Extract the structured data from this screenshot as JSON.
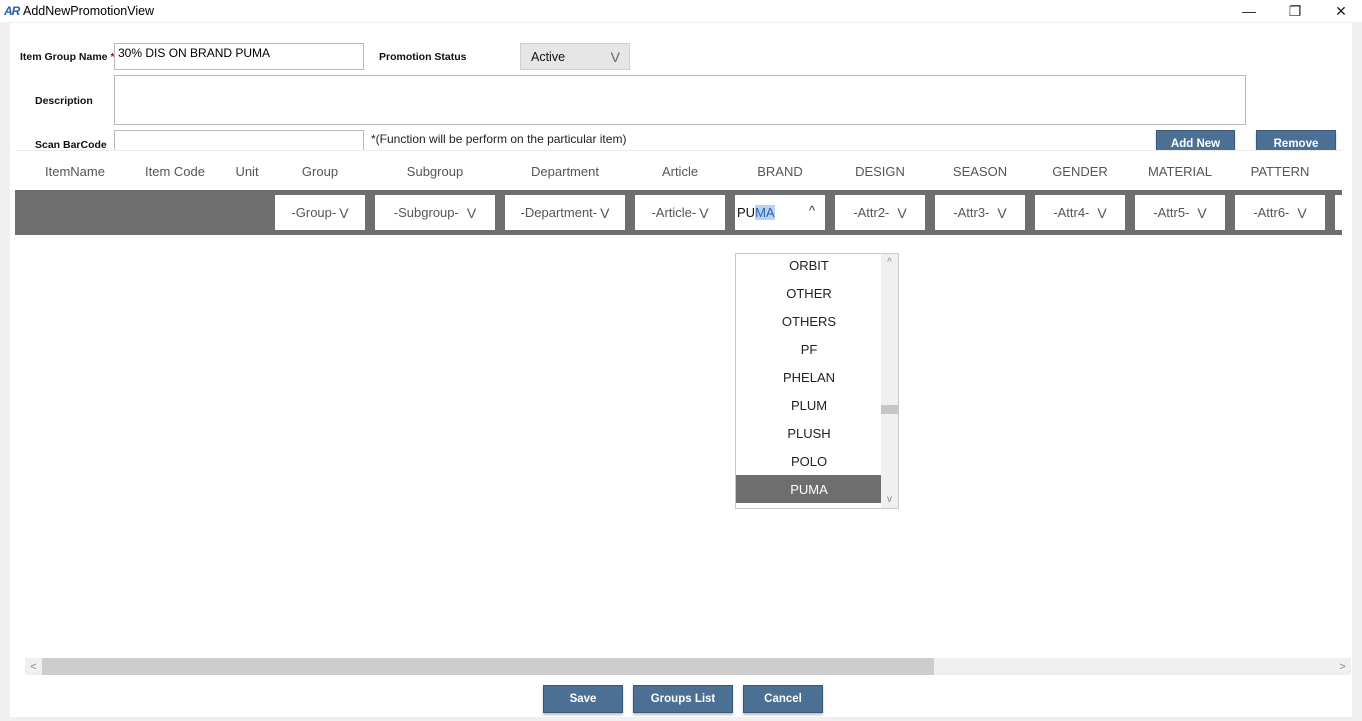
{
  "window": {
    "logo": "AR",
    "title": "AddNewPromotionView",
    "minimize_icon": "—",
    "maximize_icon": "❐",
    "close_icon": "✕"
  },
  "form": {
    "item_group_name_label": "Item Group Name",
    "required_mark": "*",
    "item_group_name_value": "30% DIS ON BRAND PUMA",
    "promotion_status_label": "Promotion Status",
    "promotion_status_value": "Active",
    "promotion_status_chevron": "V",
    "description_label": "Description",
    "description_value": "",
    "scan_barcode_label": "Scan BarCode",
    "scan_barcode_value": "",
    "scan_note": "*(Function will be perform on the particular item)"
  },
  "actions": {
    "add_new": "Add New",
    "remove": "Remove"
  },
  "grid": {
    "columns": [
      "ItemName",
      "Item Code",
      "Unit",
      "Group",
      "Subgroup",
      "Department",
      "Article",
      "BRAND",
      "DESIGN",
      "SEASON",
      "GENDER",
      "MATERIAL",
      "PATTERN"
    ],
    "filters": {
      "group": "-Group-",
      "subgroup": "-Subgroup-",
      "department": "-Department-",
      "article": "-Article-",
      "attr2": "-Attr2-",
      "attr3": "-Attr3-",
      "attr4": "-Attr4-",
      "attr5": "-Attr5-",
      "attr6": "-Attr6-",
      "chevron": "V"
    },
    "brand_filter": {
      "typed": "PU",
      "autocomplete": "MA",
      "caret": "^"
    }
  },
  "brand_dropdown": {
    "items": [
      "ORBIT",
      "OTHER",
      "OTHERS",
      "PF",
      "PHELAN",
      "PLUM",
      "PLUSH",
      "POLO",
      "PUMA"
    ],
    "selected": "PUMA",
    "scroll_position": 0.62
  },
  "footer": {
    "save": "Save",
    "groups_list": "Groups List",
    "cancel": "Cancel"
  },
  "scroll": {
    "left_arrow": "<",
    "right_arrow": ">",
    "up_arrow": "^",
    "down_arrow": "v"
  }
}
